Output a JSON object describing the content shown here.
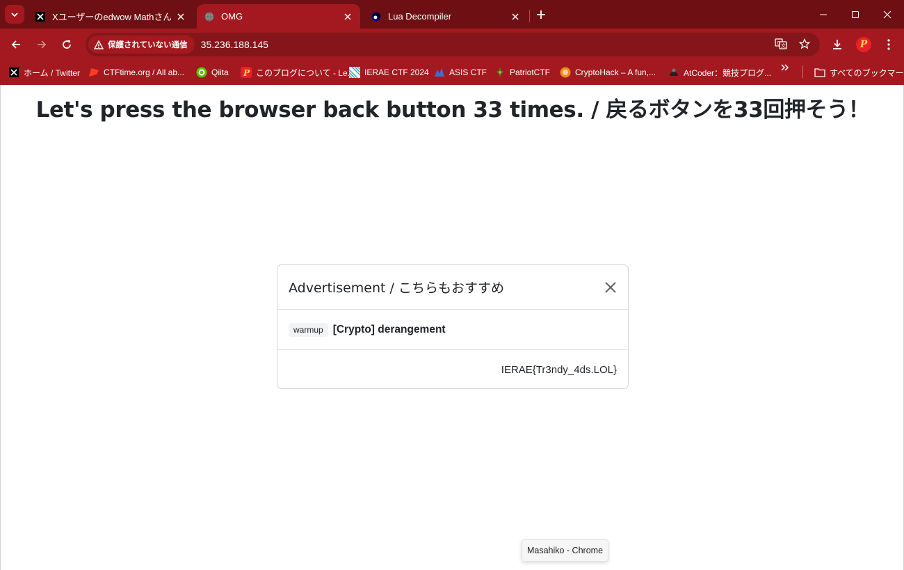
{
  "browser": {
    "tabs": [
      {
        "title": "Xユーザーのedwow Mathさん: 「安",
        "icon": "x-logo-icon",
        "active": false
      },
      {
        "title": "OMG",
        "icon": "globe-icon",
        "active": true
      },
      {
        "title": "Lua Decompiler",
        "icon": "lua-icon",
        "active": false
      }
    ],
    "security_chip": "保護されていない通信",
    "url": "35.236.188.145",
    "bookmarks": [
      {
        "label": "ホーム / Twitter",
        "icon": "x-logo-icon"
      },
      {
        "label": "CTFtime.org / All ab...",
        "icon": "ctftime-flag-icon"
      },
      {
        "label": "Qiita",
        "icon": "qiita-icon"
      },
      {
        "label": "このブログについて - Le...",
        "icon": "blog-icon"
      },
      {
        "label": "IERAE CTF 2024",
        "icon": "ierae-icon"
      },
      {
        "label": "ASIS CTF",
        "icon": "asis-icon"
      },
      {
        "label": "PatriotCTF",
        "icon": "patriotctf-icon"
      },
      {
        "label": "CryptoHack – A fun,...",
        "icon": "cryptohack-icon"
      },
      {
        "label": "AtCoder：競技プログ...",
        "icon": "atcoder-icon"
      }
    ],
    "all_bookmarks_label": "すべてのブックマーク",
    "colors": {
      "tabstrip": "#6e1013",
      "toolbar": "#a3191f",
      "omnibox": "#84161b"
    }
  },
  "page": {
    "headline": "Let's press the browser back button 33 times. / 戻るボタンを33回押そう！",
    "modal": {
      "title": "Advertisement / こちらもおすすめ",
      "badge": "warmup",
      "challenge": "[Crypto] derangement",
      "flag": "IERAE{Tr3ndy_4ds.LOL}"
    }
  },
  "tooltip": "Masahiko - Chrome"
}
